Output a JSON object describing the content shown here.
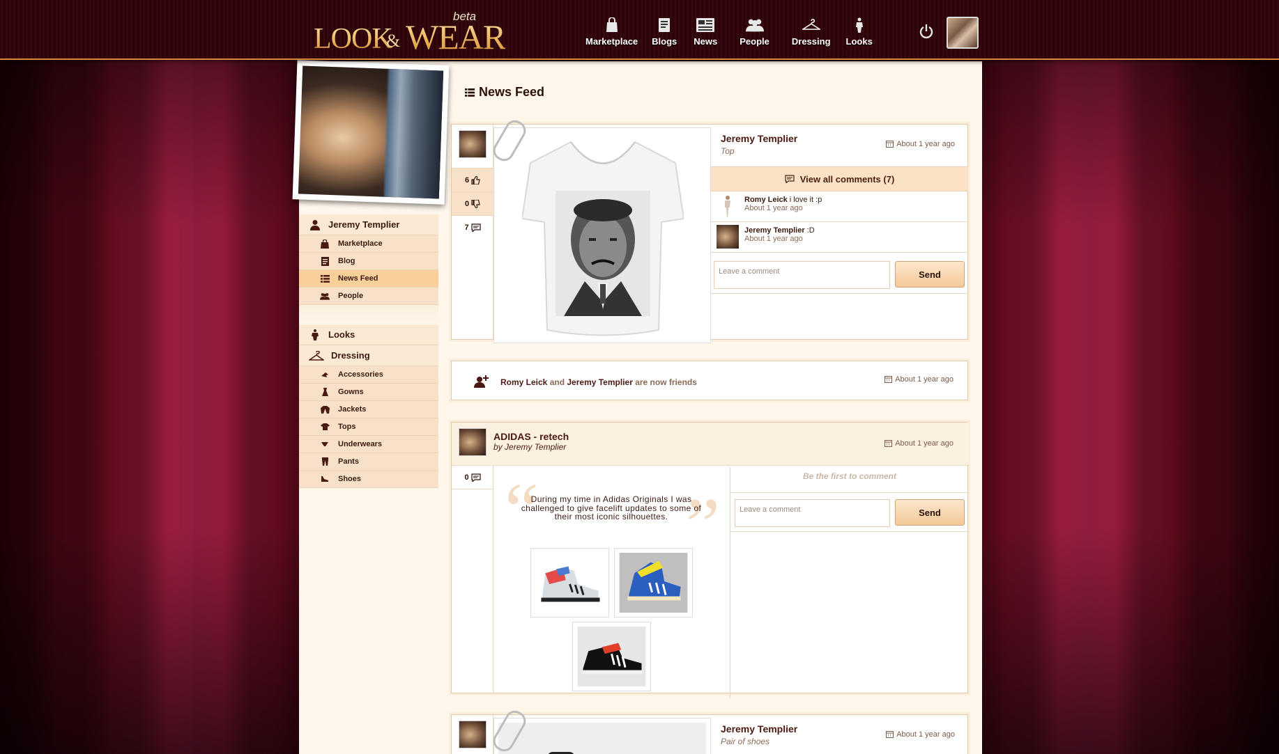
{
  "app": {
    "logo_look": "LOOK",
    "logo_amp": "&",
    "logo_wear": "WEAR",
    "logo_beta": "beta"
  },
  "nav": {
    "items": [
      {
        "label": "Marketplace",
        "icon": "bag-icon"
      },
      {
        "label": "Blogs",
        "icon": "blog-icon"
      },
      {
        "label": "News",
        "icon": "news-icon"
      },
      {
        "label": "People",
        "icon": "people-icon"
      },
      {
        "label": "Dressing",
        "icon": "hanger-icon"
      },
      {
        "label": "Looks",
        "icon": "looks-icon"
      }
    ]
  },
  "sidebar": {
    "user_name": "Jeremy Templier",
    "user_items": [
      {
        "label": "Marketplace",
        "icon": "bag-icon"
      },
      {
        "label": "Blog",
        "icon": "blog-icon"
      },
      {
        "label": "News Feed",
        "icon": "list-icon",
        "active": true
      },
      {
        "label": "People",
        "icon": "people-icon"
      }
    ],
    "looks_label": "Looks",
    "dressing_label": "Dressing",
    "dressing_items": [
      {
        "label": "Accessories"
      },
      {
        "label": "Gowns"
      },
      {
        "label": "Jackets"
      },
      {
        "label": "Tops"
      },
      {
        "label": "Underwears"
      },
      {
        "label": "Pants"
      },
      {
        "label": "Shoes"
      }
    ]
  },
  "feed": {
    "title": "News Feed",
    "post1": {
      "author": "Jeremy Templier",
      "category": "Top",
      "time": "About 1 year ago",
      "likes": "6",
      "dislikes": "0",
      "comments_count": "7",
      "view_all": "View all comments (7)",
      "comments": [
        {
          "name": "Romy Leick",
          "text": " i love it :p",
          "time": "About 1 year ago"
        },
        {
          "name": "Jeremy Templier",
          "text": " :D",
          "time": "About 1 year ago"
        }
      ],
      "comment_placeholder": "Leave a comment",
      "send_label": "Send"
    },
    "friends": {
      "a": "Romy Leick",
      "and": " and ",
      "b": "Jeremy Templier",
      "suffix": " are now friends",
      "time": "About 1 year ago"
    },
    "post2": {
      "title": "ADIDAS - retech",
      "by": "by",
      "author": "Jeremy Templier",
      "time": "About 1 year ago",
      "comments_count": "0",
      "quote": "During my time in Adidas Originals I was challenged to give facelift updates to some of their most iconic silhouettes.",
      "first_comment": "Be the first to comment",
      "comment_placeholder": "Leave a comment",
      "send_label": "Send"
    },
    "post3": {
      "author": "Jeremy Templier",
      "category": "Pair of shoes",
      "time": "About 1 year ago"
    }
  },
  "colors": {
    "accent": "#d9893a",
    "active_menu": "#f9cf9a",
    "page_bg": "#fff7ec"
  }
}
